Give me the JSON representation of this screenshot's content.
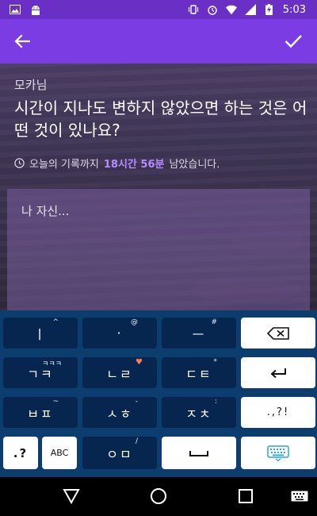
{
  "status_bar": {
    "time": "5:03",
    "left_icons": [
      "image-icon",
      "android-icon"
    ],
    "right_icons": [
      "vibrate-icon",
      "alarm-icon",
      "wifi-icon",
      "signal-icon",
      "battery-charging-icon"
    ]
  },
  "app_bar": {
    "color": "#7c3ce4",
    "back_icon": "arrow-back-icon",
    "confirm_icon": "check-icon"
  },
  "post": {
    "author": "모카님",
    "question": "시간이 지나도 변하지 않았으면 하는 것은 어떤 것이 있나요?",
    "deadline_prefix": "오늘의 기록까지",
    "deadline_highlight": "18시간 56분",
    "deadline_suffix": "남았습니다.",
    "highlight_color": "#b58cff"
  },
  "answer": {
    "placeholder": "나 자신..."
  },
  "keyboard": {
    "rows": [
      [
        {
          "label": "ㅣ",
          "hint": "^"
        },
        {
          "label": "·",
          "hint": "@"
        },
        {
          "label": "ㅡ",
          "hint": "#"
        },
        {
          "label": "⌫",
          "hint": ""
        }
      ],
      [
        {
          "label": "ㄱㅋ",
          "hint": "ㅋㅋㅋ"
        },
        {
          "label": "ㄴㄹ",
          "hint": "♥"
        },
        {
          "label": "ㄷㅌ",
          "hint": "*"
        },
        {
          "label": "↵",
          "hint": ""
        }
      ],
      [
        {
          "label": "ㅂㅍ",
          "hint": "~"
        },
        {
          "label": "ㅅㅎ",
          "hint": "-"
        },
        {
          "label": "ㅈㅊ",
          "hint": ":"
        },
        {
          "label": ".,?!",
          "hint": ""
        }
      ],
      [
        {
          "label": ".?",
          "hint": ""
        },
        {
          "label": "ABC",
          "hint": ""
        },
        {
          "label": "ㅇㅁ",
          "hint": "/"
        },
        {
          "label": "␣",
          "hint": ""
        },
        {
          "label": "keyboard-settings",
          "hint": ""
        }
      ]
    ]
  },
  "nav_bar": {
    "buttons": [
      "back-triangle-icon",
      "home-circle-icon",
      "recents-square-icon",
      "keyboard-switch-icon"
    ]
  }
}
